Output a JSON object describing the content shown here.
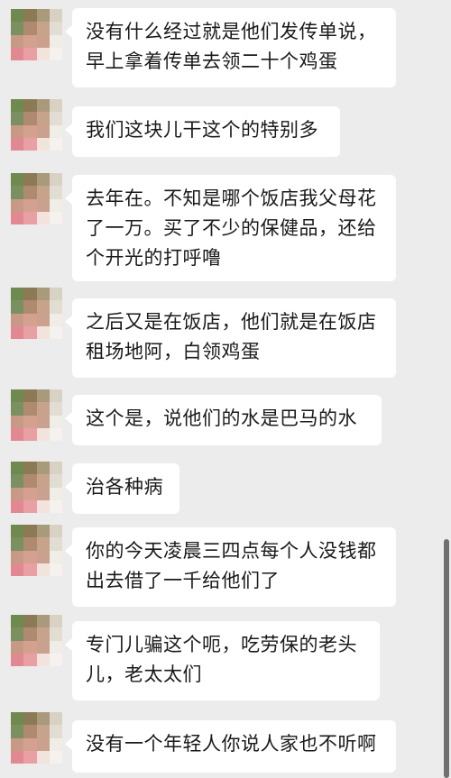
{
  "messages": [
    {
      "text": "没有什么经过就是他们发传单说，\n早上拿着传单去领二十个鸡蛋"
    },
    {
      "text": "我们这块儿干这个的特别多"
    },
    {
      "text": "去年在。不知是哪个饭店我父母花\n了一万。买了不少的保健品，还给\n个开光的打呼噜"
    },
    {
      "text": "之后又是在饭店，他们就是在饭店\n租场地阿，白领鸡蛋"
    },
    {
      "text": "这个是，说他们的水是巴马的水"
    },
    {
      "text": "治各种病"
    },
    {
      "text": "你的今天凌晨三四点每个人没钱都\n出去借了一千给他们了"
    },
    {
      "text": "专门儿骗这个呃，吃劳保的老头\n儿，老太太们"
    },
    {
      "text": "没有一个年轻人你说人家也不听啊"
    }
  ],
  "icons": {
    "avatar": "pixelated-avatar-icon"
  },
  "colors": {
    "background": "#ececec",
    "bubble": "#ffffff",
    "text": "#1a1a1a"
  }
}
